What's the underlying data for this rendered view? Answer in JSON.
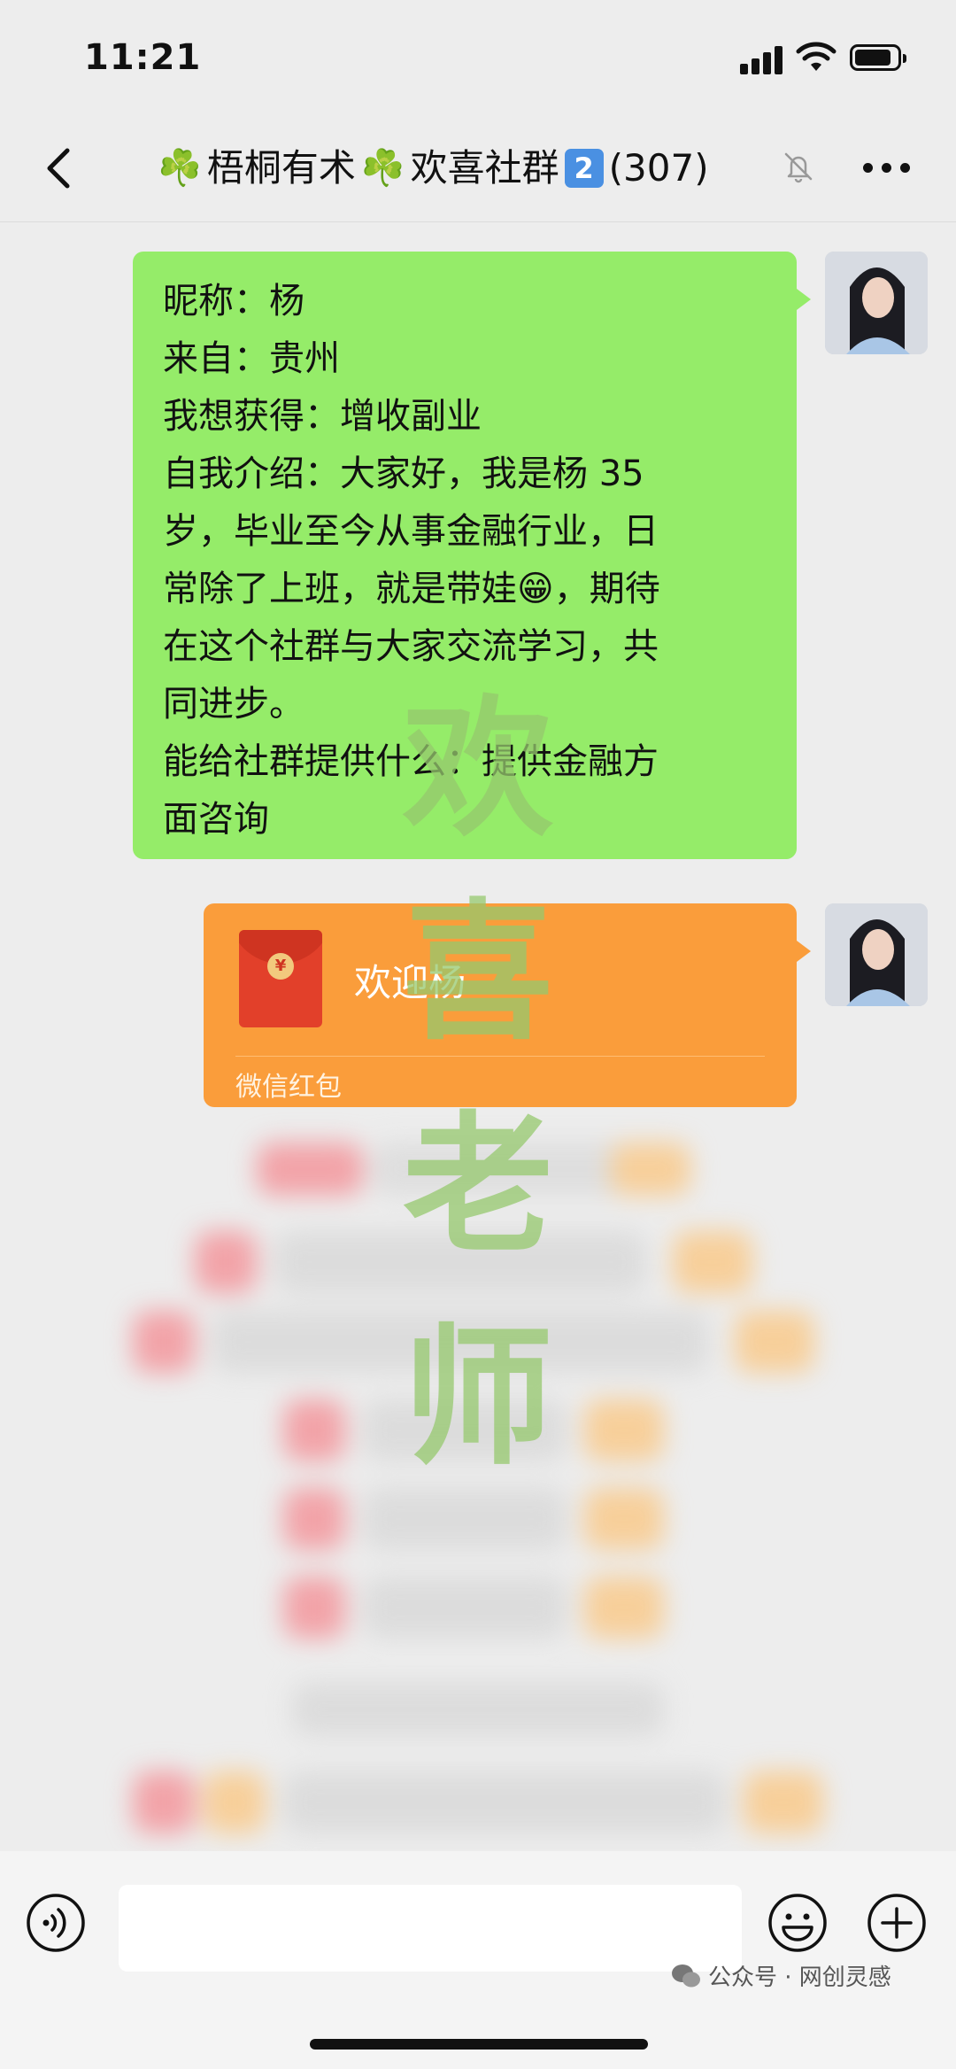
{
  "status_bar": {
    "time": "11:21"
  },
  "header": {
    "title_part1": "梧桐有术",
    "title_part2": "欢喜社群",
    "clover": "☘️",
    "badge_number": "2",
    "member_count": "(307)",
    "icons": [
      "back-icon",
      "mute-icon",
      "more-icon"
    ]
  },
  "messages": [
    {
      "type": "text",
      "lines": [
        "昵称：杨",
        "来自：贵州",
        "我想获得：增收副业",
        "自我介绍：大家好，我是杨 35",
        "岁，毕业至今从事金融行业，日",
        "常除了上班，就是带娃😁，期待",
        "在这个社群与大家交流学习，共",
        "同进步。",
        "能给社群提供什么：提供金融方",
        "面咨询"
      ]
    },
    {
      "type": "red_packet",
      "title": "欢迎杨",
      "footer": "微信红包",
      "coin_symbol": "¥"
    }
  ],
  "watermark": {
    "chars": [
      "欢",
      "喜",
      "老",
      "师"
    ]
  },
  "bottom_bar": {
    "icons": [
      "voice-icon",
      "emoji-icon",
      "plus-icon"
    ],
    "source_label": "公众号 · 网创灵感"
  },
  "colors": {
    "background": "#ededed",
    "own_bubble": "#95ec69",
    "red_packet": "#fa9d3b",
    "watermark": "#96c86e"
  }
}
